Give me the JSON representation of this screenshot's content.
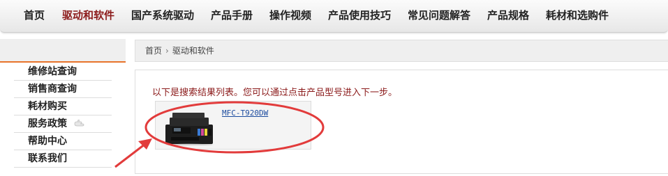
{
  "nav": {
    "items": [
      {
        "label": "首页",
        "active": false
      },
      {
        "label": "驱动和软件",
        "active": true
      },
      {
        "label": "国产系统驱动",
        "active": false
      },
      {
        "label": "产品手册",
        "active": false
      },
      {
        "label": "操作视频",
        "active": false
      },
      {
        "label": "产品使用技巧",
        "active": false
      },
      {
        "label": "常见问题解答",
        "active": false
      },
      {
        "label": "产品规格",
        "active": false
      },
      {
        "label": "耗材和选购件",
        "active": false
      }
    ]
  },
  "sidebar": {
    "items": [
      {
        "label": "维修站查询"
      },
      {
        "label": "销售商查询"
      },
      {
        "label": "耗材购买"
      },
      {
        "label": "服务政策"
      },
      {
        "label": "帮助中心"
      },
      {
        "label": "联系我们"
      }
    ]
  },
  "breadcrumb": {
    "home": "首页",
    "separator": "›",
    "current": "驱动和软件"
  },
  "results": {
    "message": "以下是搜索结果列表。您可以通过点击产品型号进入下一步。",
    "product": {
      "model": "MFC-T920DW"
    }
  },
  "colors": {
    "active_nav": "#8b1a1a",
    "message": "#8b1a1a",
    "link": "#1a4a9e",
    "accent_line": "#e8732a",
    "annotation": "#e23b3b"
  }
}
